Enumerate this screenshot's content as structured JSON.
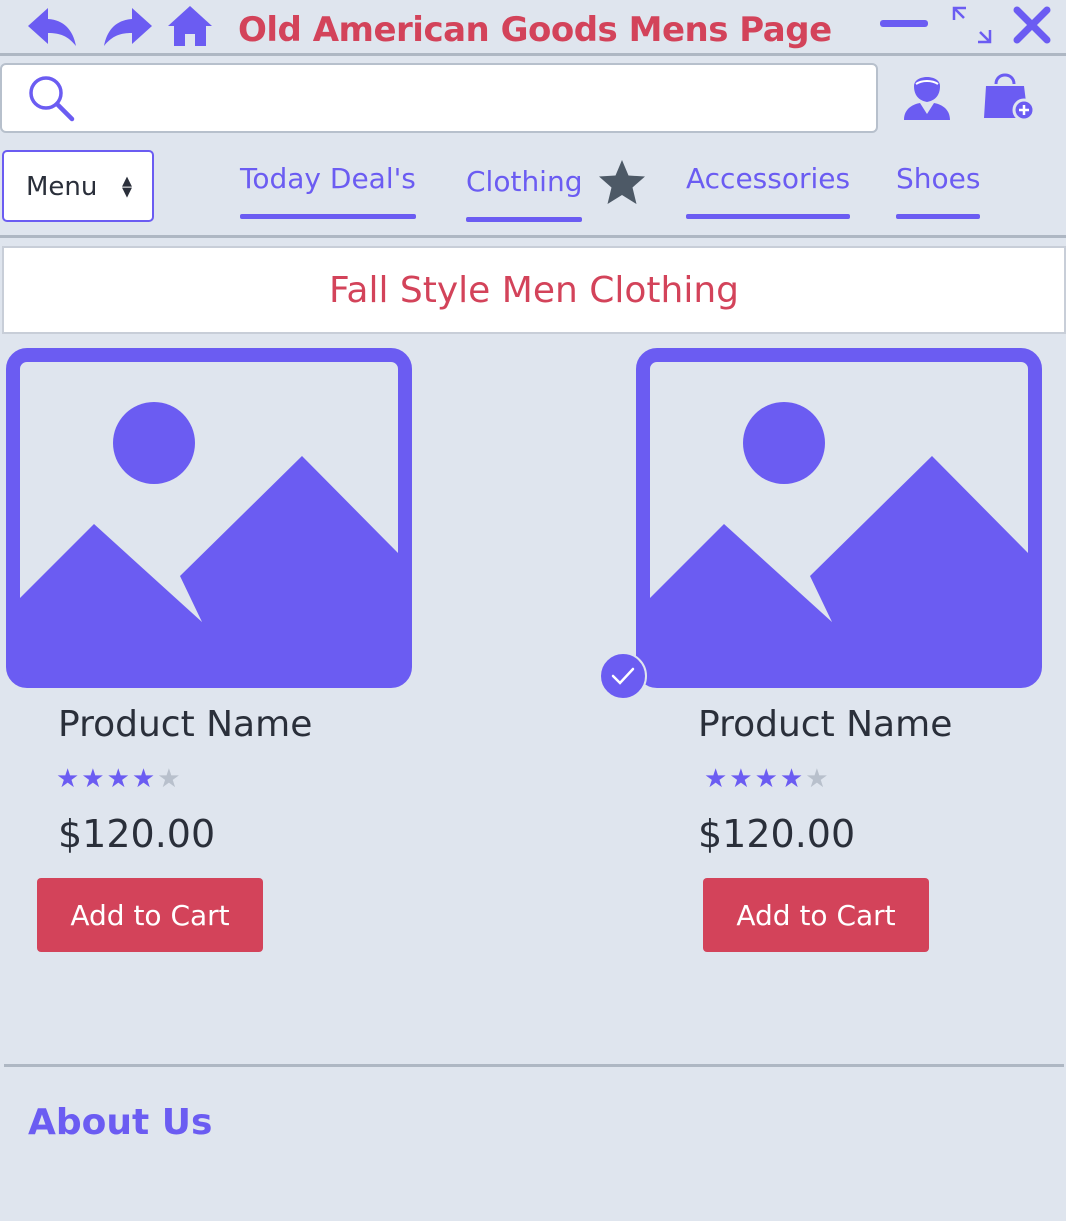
{
  "window": {
    "title": "Old American Goods Mens Page",
    "icons": [
      "back-arrow-icon",
      "forward-arrow-icon",
      "home-icon",
      "minimize-icon",
      "maximize-icon",
      "close-icon"
    ]
  },
  "header": {
    "search": {
      "placeholder": "",
      "value": ""
    },
    "icons": [
      "search-icon",
      "account-icon",
      "shopping-bag-icon"
    ]
  },
  "nav": {
    "menu_label": "Menu",
    "links": [
      "Today Deal's",
      "Clothing",
      "Accessories",
      "Shoes"
    ],
    "favorite_icon": "star-icon"
  },
  "banner": {
    "title": "Fall Style Men Clothing"
  },
  "products": [
    {
      "name": "Product Name",
      "price": "$120.00",
      "rating": 4,
      "rating_max": 5,
      "button": "Add to Cart",
      "image_icon": "image-placeholder-icon",
      "selected": false
    },
    {
      "name": "Product Name",
      "price": "$120.00",
      "rating": 4,
      "rating_max": 5,
      "button": "Add to Cart",
      "image_icon": "image-placeholder-icon",
      "selected": true
    }
  ],
  "footer": {
    "about": "About Us"
  },
  "colors": {
    "accent": "#6b5cf2",
    "brand": "#d3435a",
    "background": "#dfe5ee",
    "text": "#2a2f3a",
    "star_off": "#b8c0cc"
  }
}
